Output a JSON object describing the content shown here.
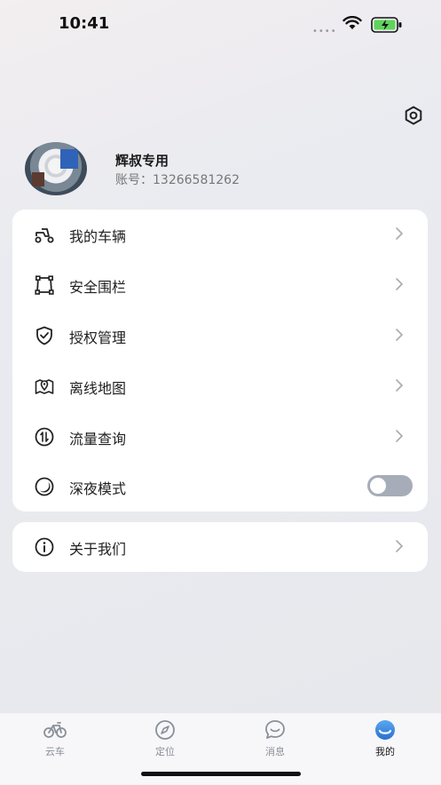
{
  "status": {
    "time": "10:41"
  },
  "profile": {
    "name": "辉叔专用",
    "account": "账号：13266581262"
  },
  "menu": [
    {
      "label": "我的车辆",
      "icon": "scooter-icon"
    },
    {
      "label": "安全围栏",
      "icon": "fence-icon"
    },
    {
      "label": "授权管理",
      "icon": "shield-check-icon"
    },
    {
      "label": "离线地图",
      "icon": "map-pin-icon"
    },
    {
      "label": "流量查询",
      "icon": "data-traffic-icon"
    },
    {
      "label": "深夜模式",
      "icon": "moon-icon",
      "toggle": false
    }
  ],
  "about": {
    "label": "关于我们",
    "icon": "info-icon"
  },
  "tabs": [
    {
      "label": "云车",
      "icon": "bicycle-icon"
    },
    {
      "label": "定位",
      "icon": "compass-icon"
    },
    {
      "label": "消息",
      "icon": "message-icon"
    },
    {
      "label": "我的",
      "icon": "profile-icon",
      "active": true
    }
  ],
  "colors": {
    "accent": "#3a8de0",
    "toggle_off": "#a6acb8"
  }
}
